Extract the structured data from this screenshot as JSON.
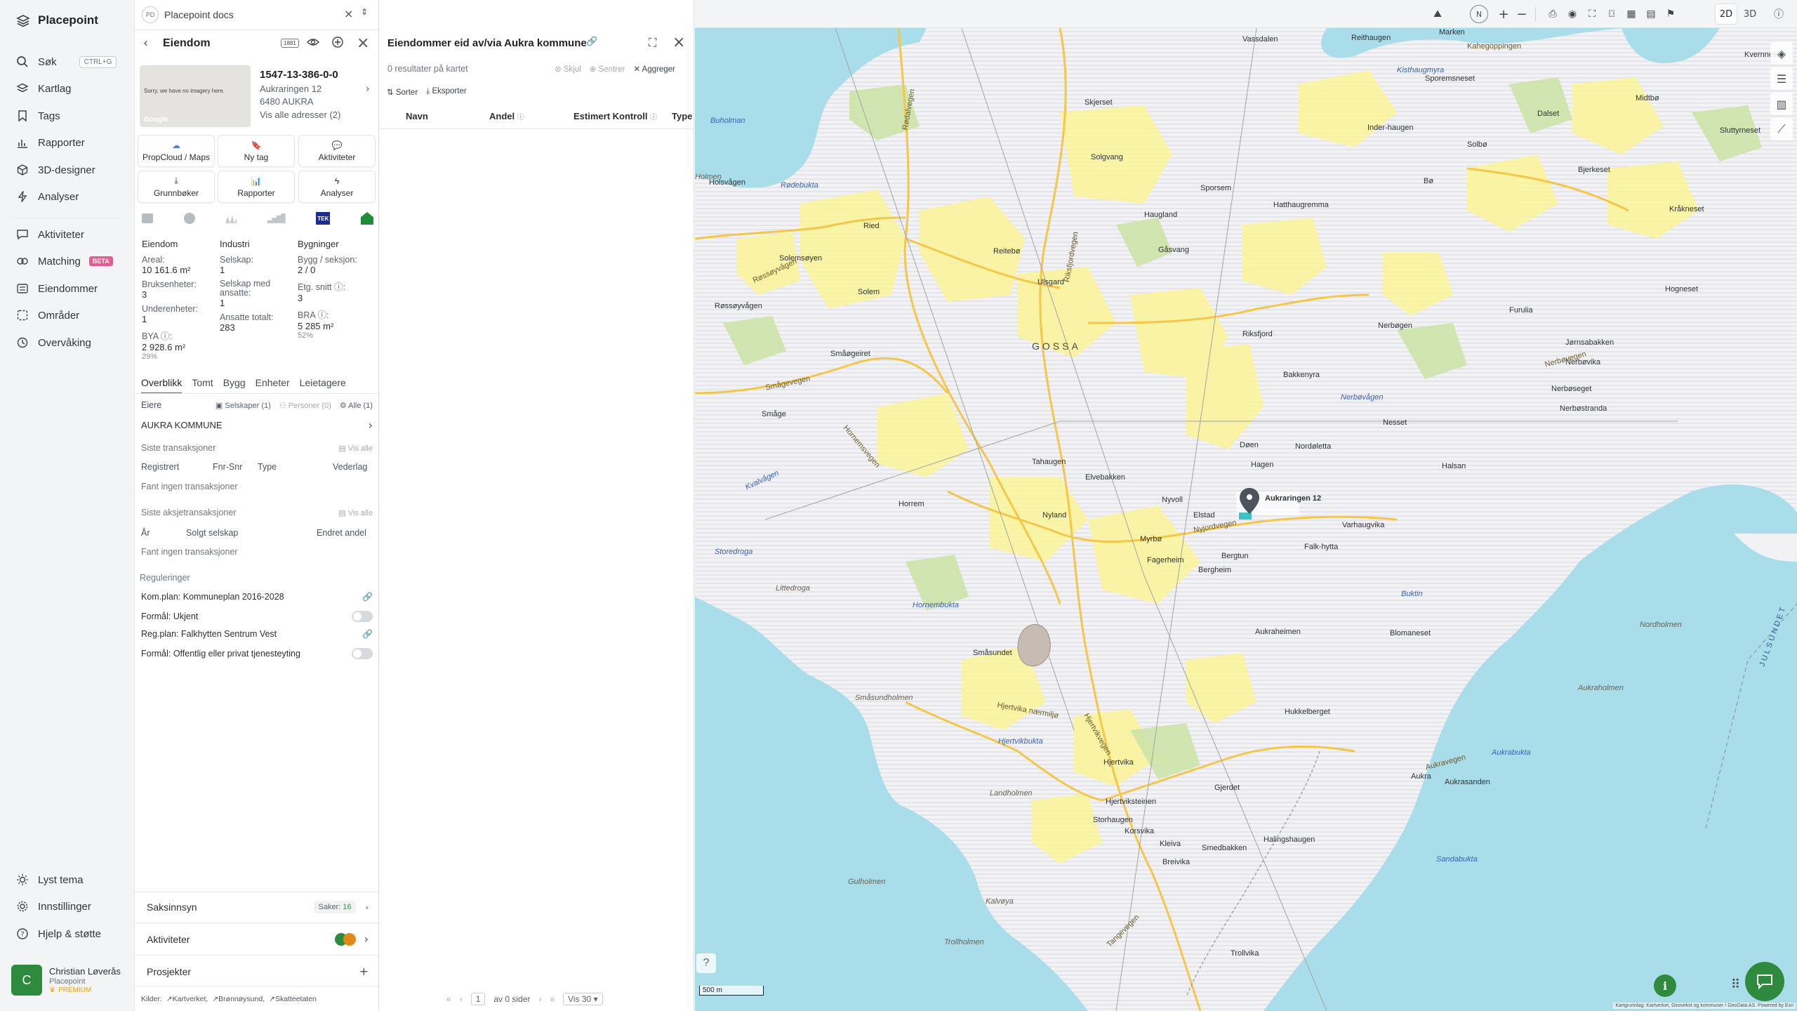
{
  "nav": {
    "brand": "Placepoint",
    "items": [
      {
        "label": "Søk",
        "shortcut": "CTRL+G",
        "icon": "search-icon"
      },
      {
        "label": "Kartlag",
        "icon": "layers-icon"
      },
      {
        "label": "Tags",
        "icon": "bookmark-icon"
      },
      {
        "label": "Rapporter",
        "icon": "chart-icon"
      },
      {
        "label": "3D-designer",
        "icon": "cube-icon"
      },
      {
        "label": "Analyser",
        "icon": "bolt-icon"
      }
    ],
    "items2": [
      {
        "label": "Aktiviteter",
        "icon": "chat-icon"
      },
      {
        "label": "Matching",
        "badge": "BETA",
        "icon": "matching-icon"
      },
      {
        "label": "Eiendommer",
        "icon": "list-icon"
      },
      {
        "label": "Områder",
        "icon": "area-icon"
      },
      {
        "label": "Overvåking",
        "icon": "monitor-icon"
      }
    ],
    "bottom": [
      {
        "label": "Lyst tema",
        "icon": "sun-icon"
      },
      {
        "label": "Innstillinger",
        "icon": "gear-icon"
      },
      {
        "label": "Hjelp & støtte",
        "icon": "help-icon"
      }
    ],
    "user": {
      "initial": "C",
      "name": "Christian Løverås",
      "org": "Placepoint",
      "plan": "PREMIUM"
    }
  },
  "doc_tab": {
    "badge": "PD",
    "title": "Placepoint docs"
  },
  "property": {
    "header": "Eiendom",
    "badge_1881": "1881",
    "id": "1547-13-386-0-0",
    "address": "Aukraringen 12",
    "postal": "6480 AUKRA",
    "all_addresses": "Vis alle adresser (2)",
    "noimagery": "Sorry, we have no imagery here.",
    "google": "Google",
    "actions": [
      "PropCloud / Maps",
      "Ny tag",
      "Aktiviteter",
      "Grunnbøker",
      "Rapporter",
      "Analyser"
    ],
    "tek": "TEK",
    "cols": [
      {
        "title": "Eiendom",
        "rows": [
          {
            "label": "Areal:",
            "value": "10 161.6 m²"
          },
          {
            "label": "Bruksenheter:",
            "value": "3"
          },
          {
            "label": "Underenheter:",
            "value": "1"
          },
          {
            "label": "BYA ⓘ:",
            "value": "2 928.6 m²",
            "sub": "29%"
          }
        ]
      },
      {
        "title": "Industri",
        "rows": [
          {
            "label": "Selskap:",
            "value": "1"
          },
          {
            "label": "Selskap med ansatte:",
            "value": "1"
          },
          {
            "label": "Ansatte totalt:",
            "value": "283"
          }
        ]
      },
      {
        "title": "Bygninger",
        "rows": [
          {
            "label": "Bygg / seksjon:",
            "value": "2 / 0"
          },
          {
            "label": "Etg. snitt ⓘ:",
            "value": "3"
          },
          {
            "label": "BRA ⓘ:",
            "value": "5 285 m²",
            "sub": "52%"
          }
        ]
      }
    ],
    "tabs": [
      "Overblikk",
      "Tomt",
      "Bygg",
      "Enheter",
      "Leietagere"
    ],
    "owners_label": "Eiere",
    "owner_filters": [
      "Selskaper (1)",
      "Personer (0)",
      "Alle (1)"
    ],
    "owner": "AUKRA KOMMUNE",
    "transactions": {
      "title": "Siste transaksjoner",
      "show_all": "Vis alle",
      "cols": [
        "Registrert",
        "Fnr-Snr",
        "Type",
        "Vederlag"
      ],
      "empty": "Fant ingen transaksjoner"
    },
    "stock_transactions": {
      "title": "Siste aksjetransaksjoner",
      "show_all": "Vis alle",
      "cols": [
        "År",
        "Solgt selskap",
        "Endret andel"
      ],
      "empty": "Fant ingen transaksjoner"
    },
    "regulations": {
      "title": "Reguleringer",
      "items": [
        {
          "label": "Kom.plan: Kommuneplan 2016-2028",
          "kind": "link"
        },
        {
          "label": "Formål: Ukjent",
          "kind": "toggle"
        },
        {
          "label": "Reg.plan: Falkhytten Sentrum Vest",
          "kind": "link"
        },
        {
          "label": "Formål: Offentlig eller privat tjenesteyting",
          "kind": "toggle"
        }
      ]
    },
    "sections": [
      {
        "label": "Saksinnsyn",
        "extra": "Saker:",
        "count": "16"
      },
      {
        "label": "Aktiviteter"
      },
      {
        "label": "Prosjekter"
      }
    ],
    "sources_label": "Kilder:",
    "sources": [
      "Kartverket",
      "Brønnøysund",
      "Skatteetaten"
    ]
  },
  "owned": {
    "title": "Eiendommer eid av/via Aukra kommune",
    "results": "0 resultater på kartet",
    "hide": "Skjul",
    "center": "Sentrer",
    "aggregate": "Aggreger",
    "sort": "Sorter",
    "export": "Eksporter",
    "cols": [
      "Navn",
      "Andel",
      "Estimert Kontroll",
      "Type"
    ],
    "pager": {
      "page": "1",
      "of": "av 0 sider",
      "per": "Vis 30"
    }
  },
  "map": {
    "modes": [
      "2D",
      "3D"
    ],
    "scale": "500 m",
    "attribution": "Kartgrunnlag: Kartverket, Geovekst og kommuner / GeoData AS. Powered by Esri",
    "marker_label": "Aukraringen 12",
    "labels": {
      "places": [
        "Solgvang",
        "Skjerset",
        "Haugland",
        "Gåsvang",
        "Reitebø",
        "Ulsgard",
        "Solem",
        "Solemsøyen",
        "Røssøyvågen",
        "Småøgeiret",
        "Småge",
        "Riksfjord",
        "Bakkenyra",
        "Nordøletta",
        "Døen",
        "Hagen",
        "Elvebakken",
        "Tahaugen",
        "Horrem",
        "Nyland",
        "Nyvoll",
        "Elstad",
        "Myrbø",
        "Bergtun",
        "Fagerheim",
        "Bergheim",
        "Falk-hytta",
        "Varhaugvika",
        "Blomaneset",
        "Aukraheimen",
        "Hukkelberget",
        "Småsundet",
        "Hjertvika",
        "Hjertviksteinen",
        "Storhaugen",
        "Korsvika",
        "Breivika",
        "Kleiva",
        "Gjerdet",
        "Smedbakken",
        "Halingshaugen",
        "Aukra",
        "Aukrasanden",
        "Ried",
        "Sporsem",
        "Sporemsneset",
        "Hatthaugremma",
        "Bø",
        "Solbø",
        "Dalset",
        "Midtbø",
        "Bjerkeset",
        "Kråkneset",
        "Furulia",
        "Nerbøgen",
        "Jørnsabakken",
        "Nerbøvika",
        "Nerbøseget",
        "Nerbøstranda",
        "Hogneset",
        "Halsan",
        "Nesset",
        "Vassdalen",
        "Reithaugen",
        "Kvernneset",
        "Sluttyrneset",
        "Marken",
        "Inder-haugen",
        "Holsvågen",
        "Trollvika"
      ],
      "water": [
        "Kisthaugmyra",
        "Rødebukta",
        "Buholman",
        "Kvalvågen",
        "Storedroga",
        "Hornembukta",
        "Hjertvikbukta",
        "Nerbøvågen",
        "Buktin",
        "Nordholmen",
        "Aukrabukta",
        "Sandabukta",
        "Gulholmen",
        "Kalvøya",
        "Trollholmen",
        "Landholmen",
        "Småsundholmen",
        "Littedroga",
        "Aukraholmen",
        "Holmen"
      ],
      "roads": [
        "Rødalvegen",
        "Røssøyvågen",
        "Smågevegen",
        "Hornemsvegen",
        "Riksfjordvegen",
        "Hjertvikvegen",
        "Nyjordvegen",
        "Aukravegen",
        "Tangevegen",
        "Hjertvika nærmiljø",
        "Kahegoppingen",
        "Nerbøvegen"
      ],
      "region": "GOSSA",
      "sea": "JULSUNDET"
    }
  }
}
